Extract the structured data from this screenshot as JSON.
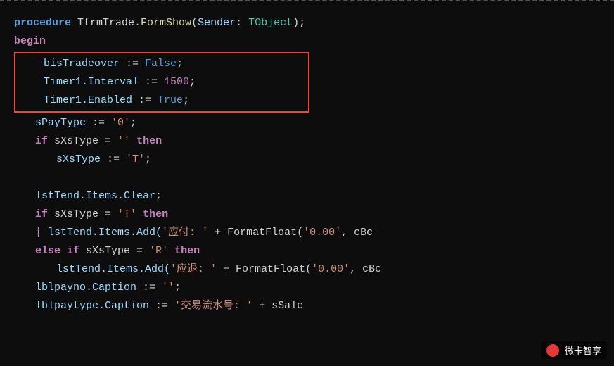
{
  "code": {
    "top_border": true,
    "lines": [
      {
        "id": "proc-line",
        "tokens": [
          {
            "text": "procedure",
            "cls": "kw-procedure"
          },
          {
            "text": " TfrmTrade.FormShow(",
            "cls": "ident-white"
          },
          {
            "text": "Sender",
            "cls": "param"
          },
          {
            "text": ": ",
            "cls": "punct"
          },
          {
            "text": "TObject",
            "cls": "type"
          },
          {
            "text": ");",
            "cls": "punct"
          }
        ],
        "indent": 0
      },
      {
        "id": "begin-line",
        "tokens": [
          {
            "text": "begin",
            "cls": "begin-kw"
          }
        ],
        "indent": 0
      },
      {
        "id": "box-line-1",
        "tokens": [
          {
            "text": "bisTradeover",
            "cls": "ident"
          },
          {
            "text": " := ",
            "cls": "op"
          },
          {
            "text": "False",
            "cls": "bool-val"
          },
          {
            "text": ";",
            "cls": "punct"
          }
        ],
        "indent": 1,
        "boxed": true
      },
      {
        "id": "box-line-2",
        "tokens": [
          {
            "text": "Timer1.Interval",
            "cls": "ident"
          },
          {
            "text": " := ",
            "cls": "op"
          },
          {
            "text": "1500",
            "cls": "number"
          },
          {
            "text": ";",
            "cls": "punct"
          }
        ],
        "indent": 1,
        "boxed": true
      },
      {
        "id": "box-line-3",
        "tokens": [
          {
            "text": "Timer1.Enabled",
            "cls": "ident"
          },
          {
            "text": " := ",
            "cls": "op"
          },
          {
            "text": "True",
            "cls": "bool-val"
          },
          {
            "text": ";",
            "cls": "punct"
          }
        ],
        "indent": 1,
        "boxed": true
      },
      {
        "id": "line-spaytype",
        "tokens": [
          {
            "text": "sPayType",
            "cls": "ident"
          },
          {
            "text": " := ",
            "cls": "op"
          },
          {
            "text": "'0'",
            "cls": "string"
          },
          {
            "text": ";",
            "cls": "punct"
          }
        ],
        "indent": 1
      },
      {
        "id": "line-if1",
        "tokens": [
          {
            "text": "if",
            "cls": "kw-if"
          },
          {
            "text": " sXsType = ",
            "cls": "ident-white"
          },
          {
            "text": "''",
            "cls": "string"
          },
          {
            "text": " ",
            "cls": "punct"
          },
          {
            "text": "then",
            "cls": "kw-then"
          }
        ],
        "indent": 1
      },
      {
        "id": "line-sxstype-assign",
        "tokens": [
          {
            "text": "sXsType",
            "cls": "ident"
          },
          {
            "text": " := ",
            "cls": "op"
          },
          {
            "text": "'T'",
            "cls": "string"
          },
          {
            "text": ";",
            "cls": "punct"
          }
        ],
        "indent": 2
      },
      {
        "id": "line-blank",
        "tokens": [],
        "indent": 0
      },
      {
        "id": "line-lsttend-clear",
        "tokens": [
          {
            "text": "lstTend.Items.Clear",
            "cls": "ident"
          },
          {
            "text": ";",
            "cls": "punct"
          }
        ],
        "indent": 1
      },
      {
        "id": "line-if2",
        "tokens": [
          {
            "text": "if",
            "cls": "kw-if"
          },
          {
            "text": " sXsType = ",
            "cls": "ident-white"
          },
          {
            "text": "'T'",
            "cls": "string"
          },
          {
            "text": " ",
            "cls": "punct"
          },
          {
            "text": "then",
            "cls": "kw-then"
          }
        ],
        "indent": 1
      },
      {
        "id": "line-pipe",
        "tokens": [
          {
            "text": "| ",
            "cls": "pipe"
          },
          {
            "text": "lstTend.Items.Add(",
            "cls": "ident"
          },
          {
            "text": "'应付: '",
            "cls": "string"
          },
          {
            "text": " + FormatFloat(",
            "cls": "ident-white"
          },
          {
            "text": "'0.00'",
            "cls": "string"
          },
          {
            "text": ", cBc",
            "cls": "ident-white"
          }
        ],
        "indent": 1
      },
      {
        "id": "line-else",
        "tokens": [
          {
            "text": "else",
            "cls": "kw-else"
          },
          {
            "text": " ",
            "cls": "punct"
          },
          {
            "text": "if",
            "cls": "kw-if"
          },
          {
            "text": " sXsType = ",
            "cls": "ident-white"
          },
          {
            "text": "'R'",
            "cls": "string"
          },
          {
            "text": " ",
            "cls": "punct"
          },
          {
            "text": "then",
            "cls": "kw-then"
          }
        ],
        "indent": 1
      },
      {
        "id": "line-lsttend-add2",
        "tokens": [
          {
            "text": "lstTend.Items.Add(",
            "cls": "ident"
          },
          {
            "text": "'应退: '",
            "cls": "string"
          },
          {
            "text": " + FormatFloat(",
            "cls": "ident-white"
          },
          {
            "text": "'0.00'",
            "cls": "string"
          },
          {
            "text": ", cBc",
            "cls": "ident-white"
          }
        ],
        "indent": 2
      },
      {
        "id": "line-lblpayno",
        "tokens": [
          {
            "text": "lblpayno.Caption",
            "cls": "ident"
          },
          {
            "text": " := ",
            "cls": "op"
          },
          {
            "text": "''",
            "cls": "string"
          },
          {
            "text": ";",
            "cls": "punct"
          }
        ],
        "indent": 1
      },
      {
        "id": "line-lblpaytype",
        "tokens": [
          {
            "text": "lblpaytype.Caption",
            "cls": "ident"
          },
          {
            "text": " := ",
            "cls": "op"
          },
          {
            "text": "'交易流水号: '",
            "cls": "string"
          },
          {
            "text": " + sSale",
            "cls": "ident-white"
          }
        ],
        "indent": 1
      }
    ],
    "watermark": {
      "text": "微卡智享",
      "show": true
    }
  }
}
